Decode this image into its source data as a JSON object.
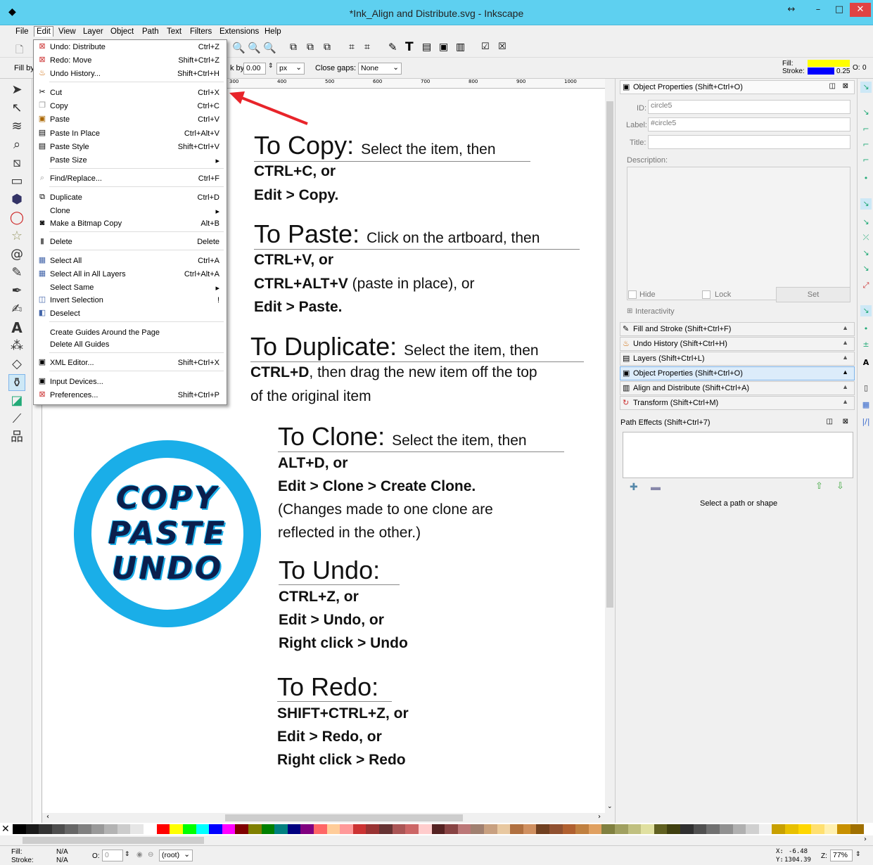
{
  "window": {
    "title": "*Ink_Align and Distribute.svg - Inkscape",
    "controls": [
      "↔",
      "–",
      "□",
      "✕"
    ]
  },
  "menubar": [
    "File",
    "Edit",
    "View",
    "Layer",
    "Object",
    "Path",
    "Text",
    "Filters",
    "Extensions",
    "Help"
  ],
  "tool_controls": {
    "fill_by_label": "Fill by",
    "grow_label": "k by:",
    "grow_value": "0.00",
    "unit": "px",
    "close_gaps_label": "Close gaps:",
    "close_gaps_value": "None"
  },
  "fill_stroke_indicator": {
    "fill_label": "Fill:",
    "stroke_label": "Stroke:",
    "fill_color": "#ffff00",
    "stroke_color": "#0000ff",
    "stroke_width": "0.25",
    "opacity_label": "O:",
    "opacity_value": "0"
  },
  "edit_menu": [
    {
      "label": "Undo: Distribute",
      "shortcut": "Ctrl+Z",
      "icon": "undo-icon"
    },
    {
      "label": "Redo: Move",
      "shortcut": "Shift+Ctrl+Z",
      "icon": "redo-icon"
    },
    {
      "label": "Undo History...",
      "shortcut": "Shift+Ctrl+H",
      "icon": "history-icon"
    },
    {
      "label": "Cut",
      "shortcut": "Ctrl+X",
      "icon": "cut-icon"
    },
    {
      "label": "Copy",
      "shortcut": "Ctrl+C",
      "icon": "copy-icon"
    },
    {
      "label": "Paste",
      "shortcut": "Ctrl+V",
      "icon": "paste-icon"
    },
    {
      "label": "Paste In Place",
      "shortcut": "Ctrl+Alt+V",
      "icon": "paste-in-place-icon"
    },
    {
      "label": "Paste Style",
      "shortcut": "Shift+Ctrl+V",
      "icon": "paste-style-icon"
    },
    {
      "label": "Paste Size",
      "shortcut": "▸",
      "icon": ""
    },
    {
      "label": "Find/Replace...",
      "shortcut": "Ctrl+F",
      "icon": "find-icon"
    },
    {
      "label": "Duplicate",
      "shortcut": "Ctrl+D",
      "icon": "duplicate-icon"
    },
    {
      "label": "Clone",
      "shortcut": "▸",
      "icon": ""
    },
    {
      "label": "Make a Bitmap Copy",
      "shortcut": "Alt+B",
      "icon": "bitmap-icon"
    },
    {
      "label": "Delete",
      "shortcut": "Delete",
      "icon": "delete-icon"
    },
    {
      "label": "Select All",
      "shortcut": "Ctrl+A",
      "icon": "select-all-icon"
    },
    {
      "label": "Select All in All Layers",
      "shortcut": "Ctrl+Alt+A",
      "icon": "select-all-layers-icon"
    },
    {
      "label": "Select Same",
      "shortcut": "▸",
      "icon": ""
    },
    {
      "label": "Invert Selection",
      "shortcut": "!",
      "icon": "invert-selection-icon"
    },
    {
      "label": "Deselect",
      "shortcut": "",
      "icon": "deselect-icon"
    },
    {
      "label": "Create Guides Around the Page",
      "shortcut": "",
      "icon": ""
    },
    {
      "label": "Delete All Guides",
      "shortcut": "",
      "icon": ""
    },
    {
      "label": "XML Editor...",
      "shortcut": "Shift+Ctrl+X",
      "icon": "xml-editor-icon"
    },
    {
      "label": "Input Devices...",
      "shortcut": "",
      "icon": "input-devices-icon"
    },
    {
      "label": "Preferences...",
      "shortcut": "Shift+Ctrl+P",
      "icon": "preferences-icon"
    }
  ],
  "document": {
    "copy_head": "To Copy:",
    "copy_sub": "Select the item, then",
    "copy_l1": "CTRL+C, or",
    "copy_l2": "Edit > Copy.",
    "paste_head": "To Paste:",
    "paste_sub": "Click on the artboard, then",
    "paste_l1": "CTRL+V, or",
    "paste_l2a": "CTRL+ALT+V",
    "paste_l2b": " (paste in place), or",
    "paste_l3": "Edit > Paste.",
    "dup_head": "To Duplicate:",
    "dup_sub": "Select the item, then",
    "dup_l1a": "CTRL+D",
    "dup_l1b": ", then drag the new item off the top",
    "dup_l2": "of the original item",
    "clone_head": "To Clone:",
    "clone_sub": "Select the item, then",
    "clone_l1": "ALT+D, or",
    "clone_l2": "Edit > Clone > Create Clone.",
    "clone_l3": "(Changes made to one clone are",
    "clone_l4": "reflected in the other.)",
    "undo_head": "To Undo:",
    "undo_l1": "CTRL+Z, or",
    "undo_l2": "Edit > Undo, or",
    "undo_l3": "Right click > Undo",
    "redo_head": "To Redo:",
    "redo_l1": "SHIFT+CTRL+Z, or",
    "redo_l2": "Edit > Redo, or",
    "redo_l3": "Right click > Redo",
    "logo": [
      "COPY",
      "PASTE",
      "UNDO"
    ]
  },
  "ruler_labels": [
    "300",
    "400",
    "500",
    "600",
    "700",
    "800",
    "900",
    "1000"
  ],
  "object_properties": {
    "header": "Object Properties (Shift+Ctrl+O)",
    "id_label": "ID:",
    "id_value": "circle5",
    "label_label": "Label:",
    "label_value": "#circle5",
    "title_label": "Title:",
    "title_value": "",
    "description_label": "Description:",
    "hide_label": "Hide",
    "lock_label": "Lock",
    "set_button": "Set",
    "interactivity_label": "Interactivity"
  },
  "dock_panels": [
    {
      "label": "Fill and Stroke (Shift+Ctrl+F)",
      "icon": "fill-stroke-icon"
    },
    {
      "label": "Undo History (Shift+Ctrl+H)",
      "icon": "history-icon"
    },
    {
      "label": "Layers (Shift+Ctrl+L)",
      "icon": "layers-icon"
    },
    {
      "label": "Object Properties (Shift+Ctrl+O)",
      "icon": "object-properties-icon"
    },
    {
      "label": "Align and Distribute (Shift+Ctrl+A)",
      "icon": "align-icon"
    },
    {
      "label": "Transform (Shift+Ctrl+M)",
      "icon": "transform-icon"
    }
  ],
  "path_effects": {
    "header": "Path Effects  (Shift+Ctrl+7)",
    "status": "Select a path or shape"
  },
  "statusbar": {
    "fill_label": "Fill:",
    "stroke_label": "Stroke:",
    "fill_value": "N/A",
    "stroke_value": "N/A",
    "opacity_label": "O:",
    "opacity_value": "0",
    "layer": "(root)",
    "x_label": "X:",
    "x_value": "-6.48",
    "y_label": "Y:",
    "y_value": "1304.39",
    "zoom_label": "Z:",
    "zoom_value": "77%"
  },
  "palette_colors": [
    "#000000",
    "#1a1a1a",
    "#333333",
    "#4d4d4d",
    "#666666",
    "#808080",
    "#999999",
    "#b3b3b3",
    "#cccccc",
    "#e6e6e6",
    "#ffffff",
    "#ff0000",
    "#ffff00",
    "#00ff00",
    "#00ffff",
    "#0000ff",
    "#ff00ff",
    "#800000",
    "#808000",
    "#008000",
    "#008080",
    "#000080",
    "#800080",
    "#ff6666",
    "#ffcc99",
    "#ff9999",
    "#cc3333",
    "#993333",
    "#663333",
    "#aa5555",
    "#cc6666",
    "#ffcccc",
    "#552222",
    "#884444",
    "#bb7777",
    "#a08070",
    "#c8a080",
    "#e8c8a0",
    "#b07040",
    "#d09060",
    "#704020",
    "#905030",
    "#b06030",
    "#c08040",
    "#e0a060",
    "#808040",
    "#a0a060",
    "#c0c080",
    "#e0e0a0",
    "#606020",
    "#404010",
    "#303030",
    "#505050",
    "#707070",
    "#909090",
    "#b0b0b0",
    "#d0d0d0",
    "#f0f0f0",
    "#c8a000",
    "#e8c000",
    "#ffd700",
    "#ffe070",
    "#fff0b0",
    "#c89000",
    "#a07000"
  ]
}
